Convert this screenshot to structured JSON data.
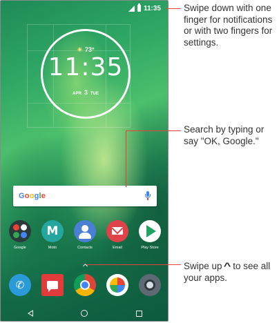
{
  "status_bar": {
    "time": "11:35"
  },
  "clock_widget": {
    "temperature": "73°",
    "time": "11:35",
    "month": "APR",
    "day": "3",
    "weekday": "TUE"
  },
  "search_bar": {
    "logo_text": "Google"
  },
  "apps": [
    {
      "name": "Google",
      "icon": "google-folder-icon"
    },
    {
      "name": "Moto",
      "icon": "moto-icon"
    },
    {
      "name": "Contacts",
      "icon": "contacts-icon"
    },
    {
      "name": "Email",
      "icon": "email-icon"
    },
    {
      "name": "Play Store",
      "icon": "play-store-icon"
    }
  ],
  "dock": [
    {
      "icon": "phone-icon"
    },
    {
      "icon": "messages-icon"
    },
    {
      "icon": "chrome-icon"
    },
    {
      "icon": "photos-icon"
    },
    {
      "icon": "camera-icon"
    }
  ],
  "callouts": {
    "notifications": "Swipe down with one finger for notifications or with two fingers for settings.",
    "search": "Search by typing or say \"OK, Google.\"",
    "apps_prefix": "Swipe up",
    "apps_suffix": "to see all your apps."
  },
  "colors": {
    "callout_line": "#e8433a",
    "google_blue": "#4285f4",
    "google_red": "#ea4335",
    "google_yellow": "#fbbc05",
    "google_green": "#34a853"
  }
}
